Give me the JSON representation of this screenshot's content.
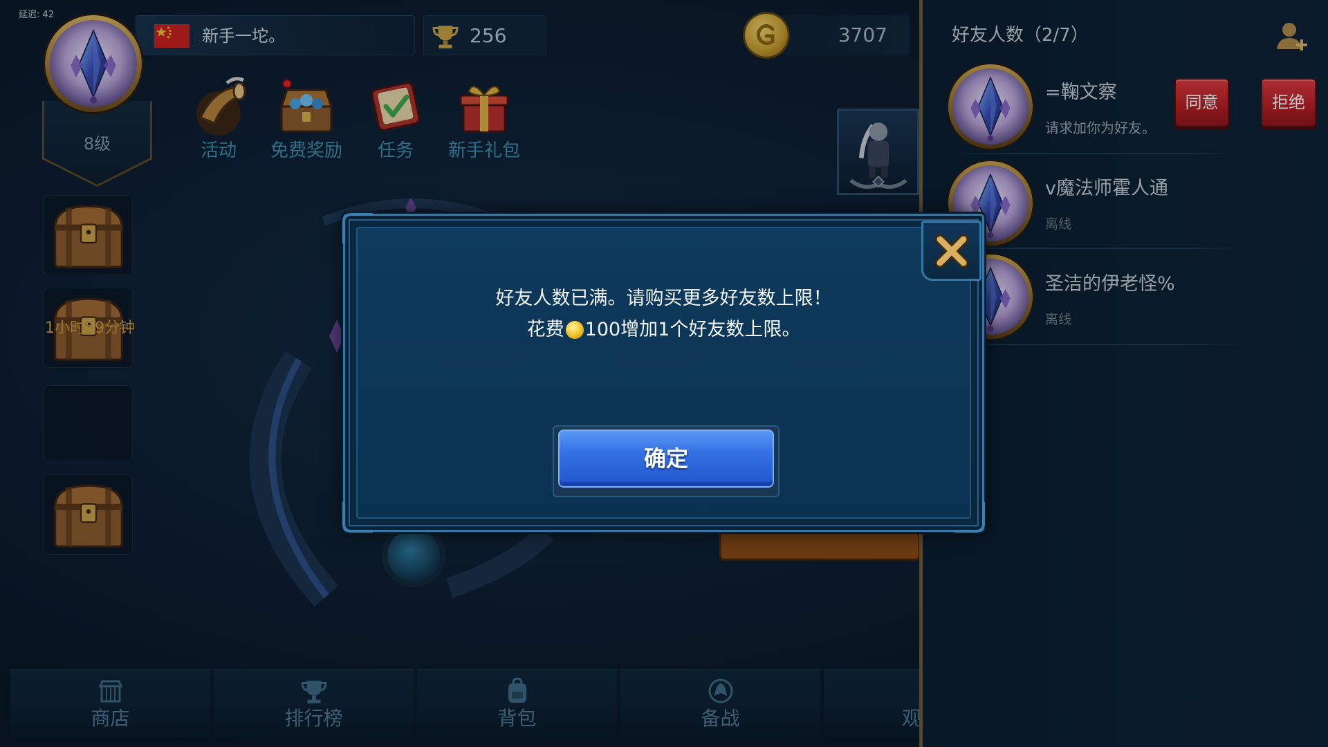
{
  "status": {
    "latency": "延迟: 42"
  },
  "player": {
    "level": "8级",
    "name": "新手一坨。",
    "trophies": "256",
    "gold": "3707"
  },
  "menu": [
    {
      "label": "活动",
      "icon": "horn-icon"
    },
    {
      "label": "免费奖励",
      "icon": "treasure-chest-icon",
      "has_notification": true
    },
    {
      "label": "任务",
      "icon": "task-book-icon"
    },
    {
      "label": "新手礼包",
      "icon": "gift-box-icon"
    }
  ],
  "chest_timer": "1小时59分钟",
  "bottom_nav": [
    {
      "label": "商店",
      "icon": "shop-icon"
    },
    {
      "label": "排行榜",
      "icon": "trophy-icon"
    },
    {
      "label": "背包",
      "icon": "backpack-icon"
    },
    {
      "label": "备战",
      "icon": "battle-icon"
    },
    {
      "label": "观"
    }
  ],
  "friends_panel": {
    "title": "好友人数（2/7）",
    "add_friend_icon": "add-friend-icon",
    "accept_label": "同意",
    "reject_label": "拒绝",
    "friends": [
      {
        "name": "=鞠文察",
        "status": "请求加你为好友。"
      },
      {
        "name": "v魔法师霍人通",
        "status": "离线"
      },
      {
        "name": "圣洁的伊老怪%",
        "status": "离线"
      }
    ]
  },
  "dialog": {
    "message_line1": "好友人数已满。请购买更多好友数上限！",
    "message_line2_prefix": "花费",
    "message_line2_suffix": "100增加1个好友数上限。",
    "confirm_label": "确定",
    "close_icon": "close-icon"
  },
  "colors": {
    "accent_gold": "#c9a24a",
    "dialog_bg": "#0c3352",
    "confirm_blue": "#2f6be0",
    "reject_red": "#c3262b",
    "panel_bg": "#0c1f30"
  }
}
